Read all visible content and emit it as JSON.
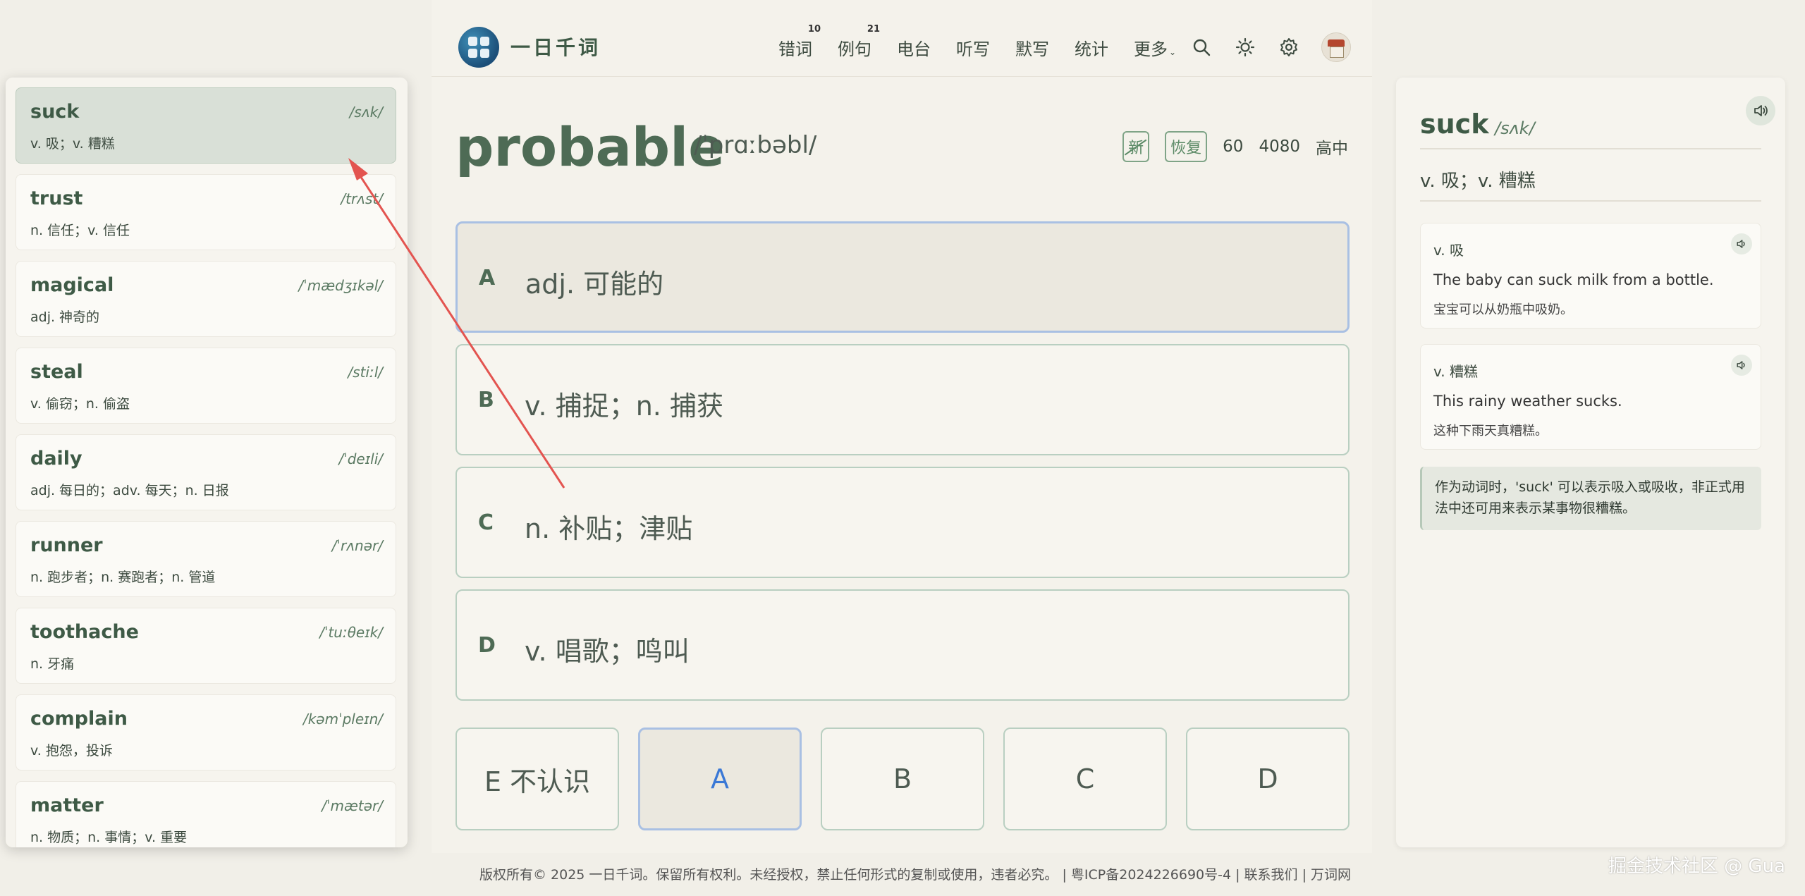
{
  "app": {
    "title": "一日千词"
  },
  "nav": {
    "items": [
      {
        "label": "错词",
        "count": "10"
      },
      {
        "label": "例句",
        "count": "21"
      },
      {
        "label": "电台",
        "count": ""
      },
      {
        "label": "听写",
        "count": ""
      },
      {
        "label": "默写",
        "count": ""
      },
      {
        "label": "统计",
        "count": ""
      },
      {
        "label": "更多",
        "count": ""
      }
    ],
    "icons": [
      "search-icon",
      "sun-icon",
      "gear-icon",
      "avatar"
    ]
  },
  "wordlist": [
    {
      "word": "suck",
      "phonetic": "/sʌk/",
      "meaning": "v. 吸；v. 糟糕"
    },
    {
      "word": "trust",
      "phonetic": "/trʌst/",
      "meaning": "n. 信任；v. 信任"
    },
    {
      "word": "magical",
      "phonetic": "/ˈmædʒɪkəl/",
      "meaning": "adj. 神奇的"
    },
    {
      "word": "steal",
      "phonetic": "/stiːl/",
      "meaning": "v. 偷窃；n. 偷盗"
    },
    {
      "word": "daily",
      "phonetic": "/ˈdeɪli/",
      "meaning": "adj. 每日的；adv. 每天；n. 日报"
    },
    {
      "word": "runner",
      "phonetic": "/ˈrʌnər/",
      "meaning": "n. 跑步者；n. 赛跑者；n. 管道"
    },
    {
      "word": "toothache",
      "phonetic": "/ˈtuːθeɪk/",
      "meaning": "n. 牙痛"
    },
    {
      "word": "complain",
      "phonetic": "/kəmˈpleɪn/",
      "meaning": "v. 抱怨，投诉"
    },
    {
      "word": "matter",
      "phonetic": "/ˈmætər/",
      "meaning": "n. 物质；n. 事情；v. 重要"
    }
  ],
  "question": {
    "word": "probable",
    "phonetic": "/ˈprɑːbəbl/",
    "tag_new": "新",
    "tag_restore": "恢复",
    "num1": "60",
    "num2": "4080",
    "level": "高中",
    "options": [
      {
        "letter": "A",
        "text": "adj. 可能的"
      },
      {
        "letter": "B",
        "text": "v. 捕捉；n. 捕获"
      },
      {
        "letter": "C",
        "text": "n. 补贴；津贴"
      },
      {
        "letter": "D",
        "text": "v. 唱歌；鸣叫"
      }
    ],
    "selected": "A"
  },
  "answers": [
    "E 不认识",
    "A",
    "B",
    "C",
    "D"
  ],
  "footer": {
    "text": "版权所有© 2025 一日千词。保留所有权利。未经授权，禁止任何形式的复制或使用，违者必究。 | 粤ICP备2024226690号-4 | 联系我们  | 万词网"
  },
  "detail": {
    "word": "suck",
    "phonetic": "/sʌk/",
    "meaning": "v. 吸；v. 糟糕",
    "examples": [
      {
        "pos": "v. 吸",
        "en": "The baby can suck milk from a bottle.",
        "zh": "宝宝可以从奶瓶中吸奶。"
      },
      {
        "pos": "v. 糟糕",
        "en": "This rainy weather sucks.",
        "zh": "这种下雨天真糟糕。"
      }
    ],
    "note": "作为动词时，'suck' 可以表示吸入或吸收，非正式用法中还可用来表示某事物很糟糕。"
  },
  "watermark": "掘金技术社区 @ Gua",
  "colors": {
    "accent": "#4e6b55",
    "selected_border": "#a9c0e3",
    "selected_text": "#3a78d6",
    "arrow": "#e35450"
  }
}
